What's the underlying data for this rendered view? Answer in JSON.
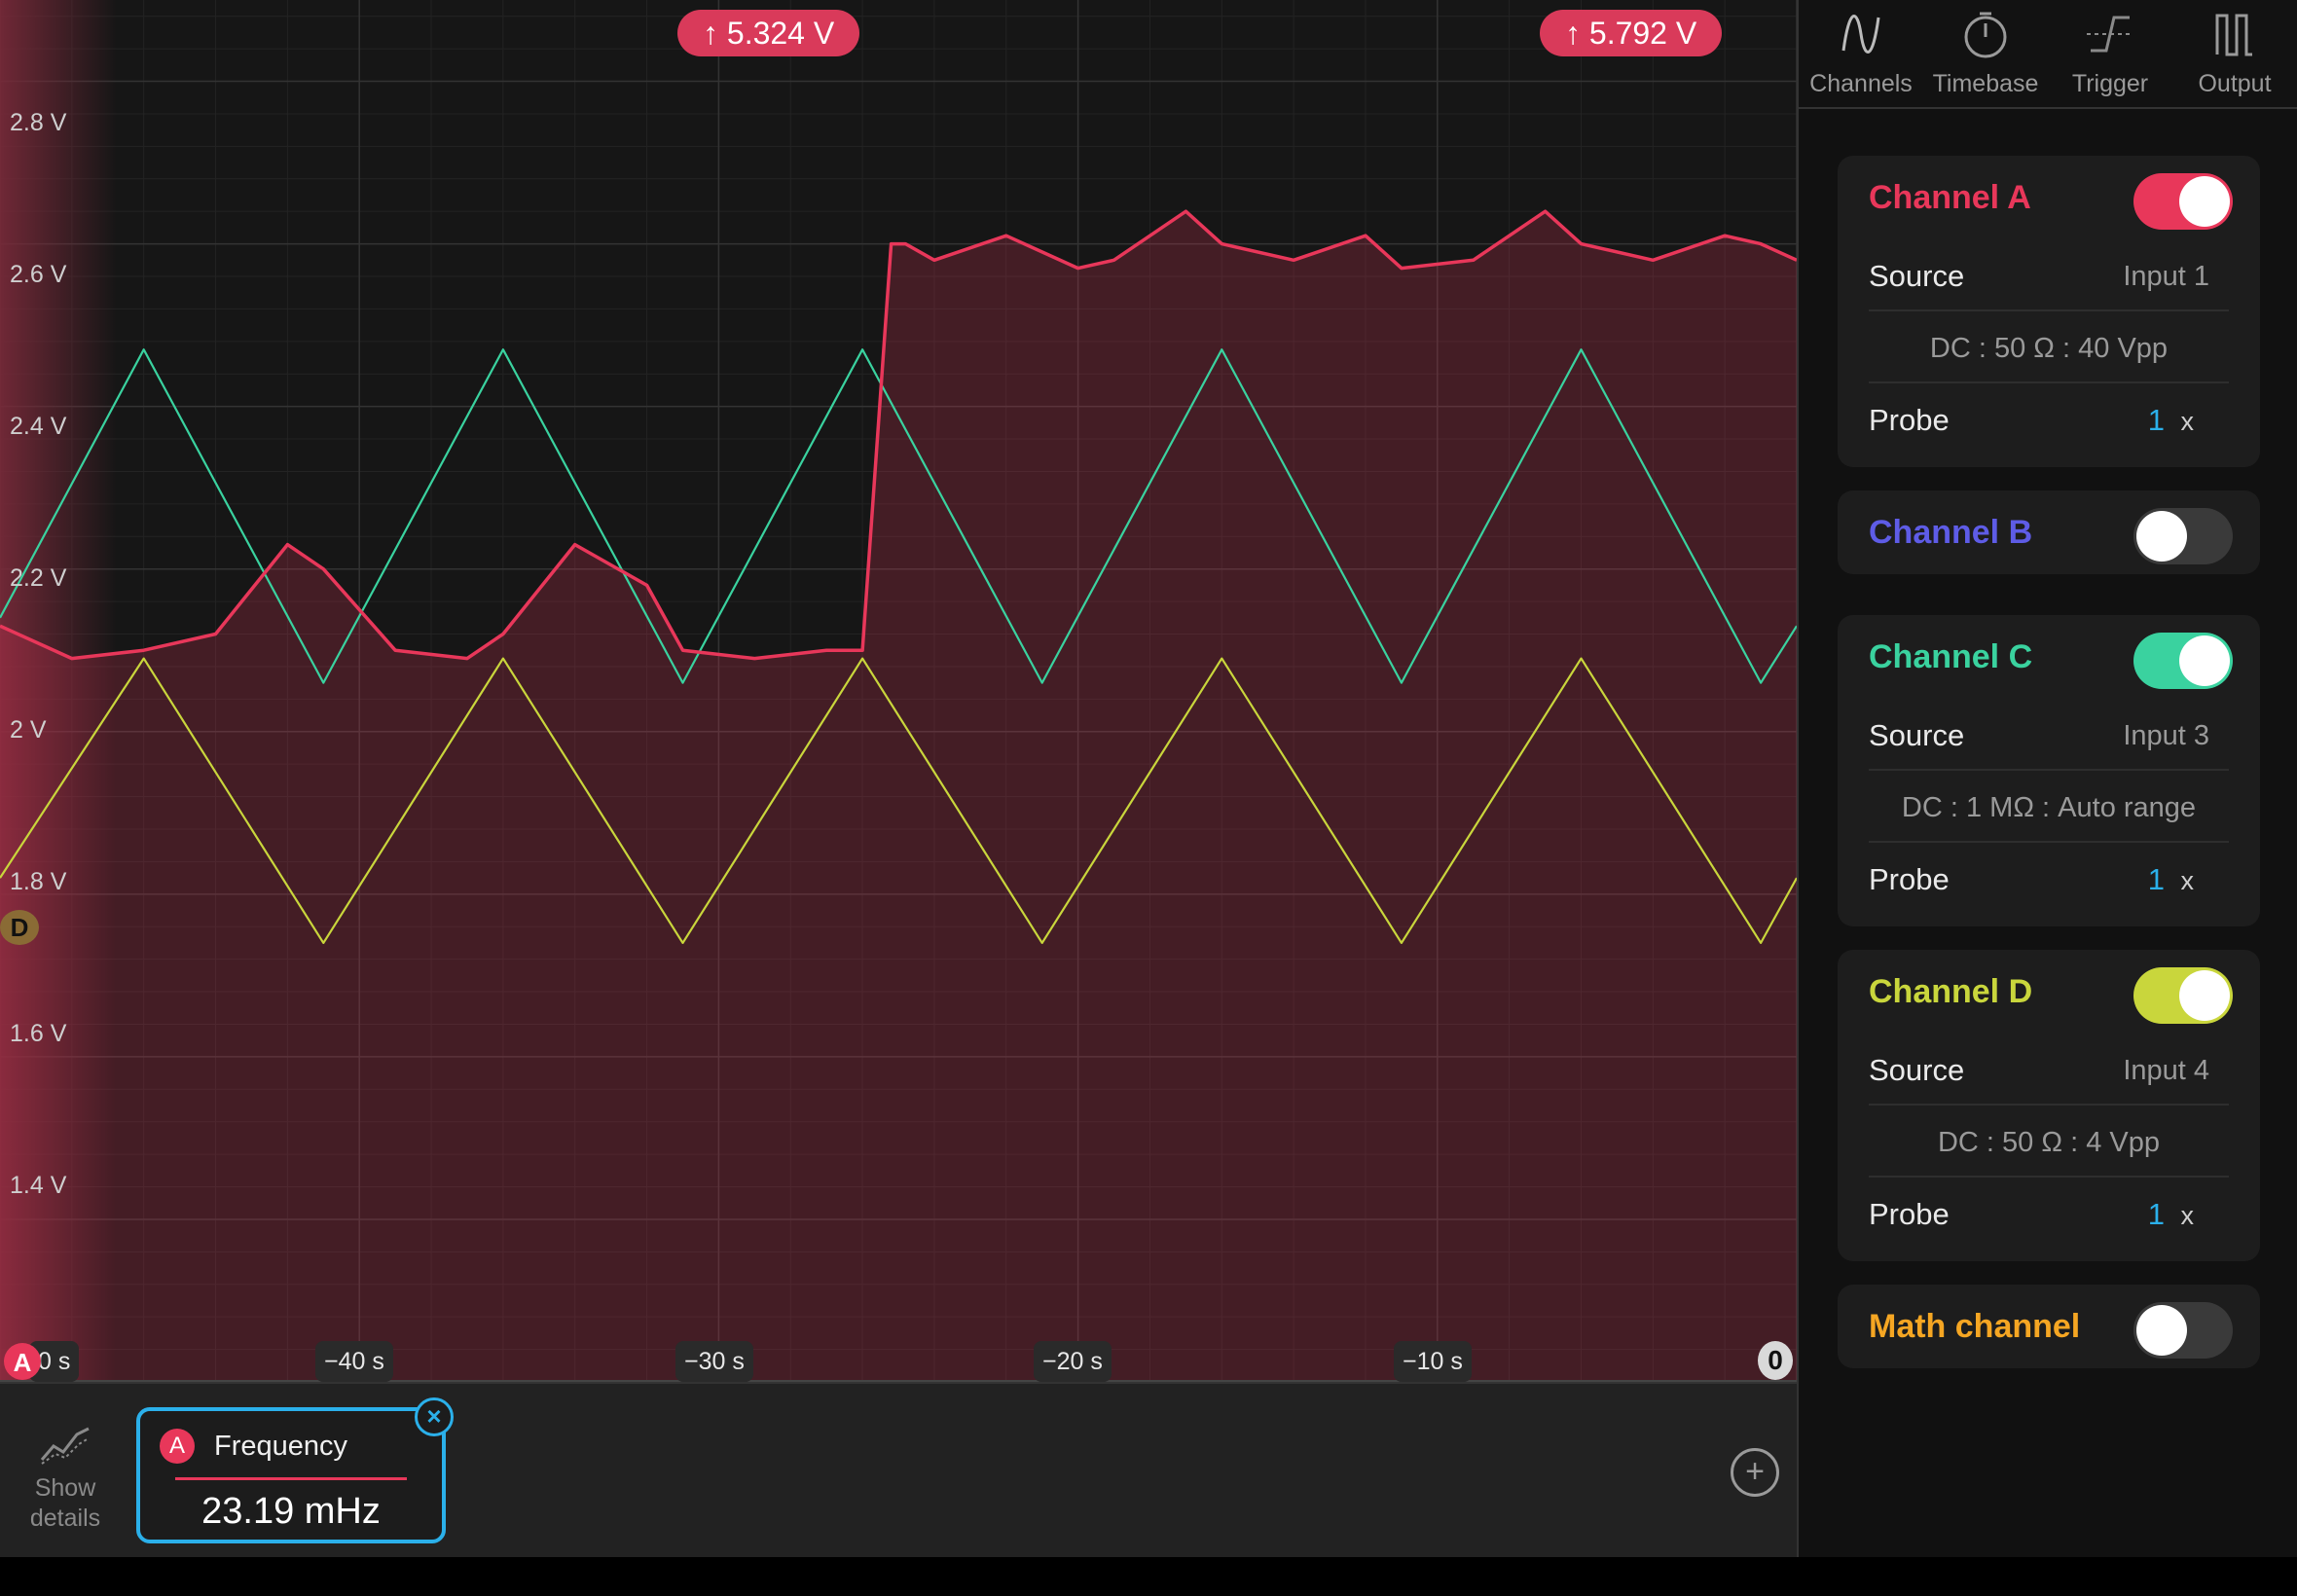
{
  "y_axis_labels": [
    "2.8 V",
    "2.6 V",
    "2.4 V",
    "2.2 V",
    "2 V",
    "1.8 V",
    "1.6 V",
    "1.4 V"
  ],
  "x_axis_labels": [
    "0 s",
    "−40 s",
    "−30 s",
    "−20 s",
    "−10 s"
  ],
  "peak_labels": [
    "↑ 5.324 V",
    "↑ 5.792 V"
  ],
  "markers": {
    "a": "A",
    "d": "D",
    "zero": "0"
  },
  "colors": {
    "channel_a": "#e8375a",
    "channel_b": "#5e5ce6",
    "channel_c": "#3ad29f",
    "channel_d": "#c9d63c",
    "math": "#f5a623",
    "accent": "#2bb0ea"
  },
  "tabs": [
    {
      "label": "Channels",
      "icon": "sine-wave-icon"
    },
    {
      "label": "Timebase",
      "icon": "stopwatch-icon"
    },
    {
      "label": "Trigger",
      "icon": "trigger-edge-icon"
    },
    {
      "label": "Output",
      "icon": "square-wave-icon"
    }
  ],
  "channels": {
    "a": {
      "title": "Channel A",
      "enabled": true,
      "source_label": "Source",
      "source_value": "Input 1",
      "config": "DC : 50 Ω : 40 Vpp",
      "probe_label": "Probe",
      "probe_value": "1",
      "probe_unit": "x"
    },
    "b": {
      "title": "Channel B",
      "enabled": false
    },
    "c": {
      "title": "Channel C",
      "enabled": true,
      "source_label": "Source",
      "source_value": "Input 3",
      "config": "DC : 1 MΩ : Auto range",
      "probe_label": "Probe",
      "probe_value": "1",
      "probe_unit": "x"
    },
    "d": {
      "title": "Channel D",
      "enabled": true,
      "source_label": "Source",
      "source_value": "Input 4",
      "config": "DC : 50 Ω : 4 Vpp",
      "probe_label": "Probe",
      "probe_value": "1",
      "probe_unit": "x"
    },
    "math": {
      "title": "Math channel",
      "enabled": false
    }
  },
  "bottom": {
    "show_details": "Show details",
    "measurement": {
      "channel": "A",
      "name": "Frequency",
      "value": "23.19 mHz"
    }
  },
  "chart_data": {
    "type": "line",
    "xlim": [
      -50,
      0
    ],
    "ylim": [
      1.2,
      2.9
    ],
    "series": [
      {
        "channel": "C",
        "x": [
          -50,
          -46,
          -41,
          -36,
          -31,
          -26,
          -21,
          -16,
          -11,
          -6,
          -1,
          0
        ],
        "y": [
          2.14,
          2.47,
          2.06,
          2.47,
          2.06,
          2.47,
          2.06,
          2.47,
          2.06,
          2.47,
          2.06,
          2.13
        ]
      },
      {
        "channel": "D",
        "x": [
          -50,
          -46,
          -41,
          -36,
          -31,
          -26,
          -21,
          -16,
          -11,
          -6,
          -1,
          0
        ],
        "y": [
          1.82,
          2.09,
          1.74,
          2.09,
          1.74,
          2.09,
          1.74,
          2.09,
          1.74,
          2.09,
          1.74,
          1.82
        ]
      },
      {
        "channel": "A",
        "x": [
          -50,
          -48,
          -46,
          -44,
          -42,
          -41,
          -39,
          -37,
          -36,
          -34,
          -32,
          -31,
          -29,
          -27,
          -26,
          -25.2,
          -24.8,
          -24,
          -22,
          -20,
          -19,
          -17,
          -16,
          -14,
          -12,
          -11,
          -9,
          -7,
          -6,
          -4,
          -2,
          -1,
          0
        ],
        "y": [
          2.13,
          2.09,
          2.1,
          2.12,
          2.23,
          2.2,
          2.1,
          2.09,
          2.12,
          2.23,
          2.18,
          2.1,
          2.09,
          2.1,
          2.1,
          2.6,
          2.6,
          2.58,
          2.61,
          2.57,
          2.58,
          2.64,
          2.6,
          2.58,
          2.61,
          2.57,
          2.58,
          2.64,
          2.6,
          2.58,
          2.61,
          2.6,
          2.58
        ]
      }
    ]
  }
}
